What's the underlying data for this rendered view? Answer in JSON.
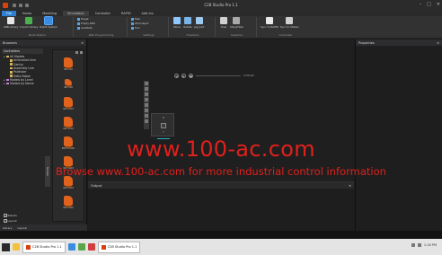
{
  "window": {
    "title": "C2B Studio Pro 1.1",
    "controls": [
      "–",
      "□",
      "✕"
    ]
  },
  "ribbon": {
    "tabs": [
      "File",
      "Home",
      "Modeling",
      "Simulation",
      "Controller",
      "RAPID",
      "Add-Ins"
    ],
    "groups": [
      {
        "label": "Build Station",
        "buttons": [
          "ABB Library",
          "Import Library",
          "Robot System"
        ]
      },
      {
        "label": "Path Programming",
        "buttons": [
          "Target",
          "Empty Path",
          "AutoPath"
        ]
      },
      {
        "label": "Settings",
        "buttons": [
          "Task",
          "Workobject",
          "Tool"
        ]
      },
      {
        "label": "Freehand",
        "buttons": [
          "Move",
          "Rotate",
          "Jog Joint"
        ]
      },
      {
        "label": "Graphics",
        "buttons": [
          "View",
          "Show/Hide"
        ]
      },
      {
        "label": "Controller",
        "buttons": [
          "Sync to RAPID",
          "Sync to Station"
        ]
      }
    ]
  },
  "left_panel": {
    "title": "Browsers",
    "tree": {
      "header": "Controllers",
      "items": [
        {
          "label": "All Models",
          "level": 1,
          "type": "folder"
        },
        {
          "label": "Articulated Arm",
          "level": 2,
          "type": "folder"
        },
        {
          "label": "Gantry",
          "level": 2,
          "type": "folder"
        },
        {
          "label": "Assembly Line",
          "level": 2,
          "type": "folder"
        },
        {
          "label": "Palletizer",
          "level": 2,
          "type": "folder"
        },
        {
          "label": "Delta Robot",
          "level": 2,
          "type": "folder"
        },
        {
          "label": "Models by Level",
          "level": 1,
          "type": "purple"
        },
        {
          "label": "Models by Name",
          "level": 1,
          "type": "purple"
        }
      ]
    },
    "models": [
      {
        "name": "IRB 120",
        "small": false
      },
      {
        "name": "IRB 140",
        "small": true
      },
      {
        "name": "IRB 1200",
        "small": false
      },
      {
        "name": "IRB 1410",
        "small": false
      },
      {
        "name": "IRB 1520ID",
        "small": false
      },
      {
        "name": "IRB 1600",
        "small": false
      },
      {
        "name": "IRB 2400",
        "small": false
      },
      {
        "name": "IRB 2600",
        "small": false
      }
    ],
    "side_tab": "Models",
    "checkboxes": [
      {
        "label": "Robots",
        "checked": true
      },
      {
        "label": "Layout",
        "checked": true
      },
      {
        "label": "Axis",
        "checked": false
      }
    ],
    "footer_tabs": [
      "Library",
      "Layout"
    ]
  },
  "viewport": {
    "time": "0:00:00",
    "cube_top": "Z",
    "cube_bottom": "Y"
  },
  "output": {
    "title": "Output"
  },
  "properties": {
    "title": "Properties"
  },
  "watermark": {
    "line1": "www.100-ac.com",
    "line2": "Browse www.100-ac.com for more industrial control information"
  },
  "taskbar": {
    "tasks": [
      "C2B Studio Pro 1.1",
      "C2B Studio Pro 1.1"
    ],
    "clock": "1:16 PM"
  },
  "colors": {
    "accent": "#2c7fd1",
    "robot": "#e0621c",
    "watermark": "#e0201c"
  }
}
